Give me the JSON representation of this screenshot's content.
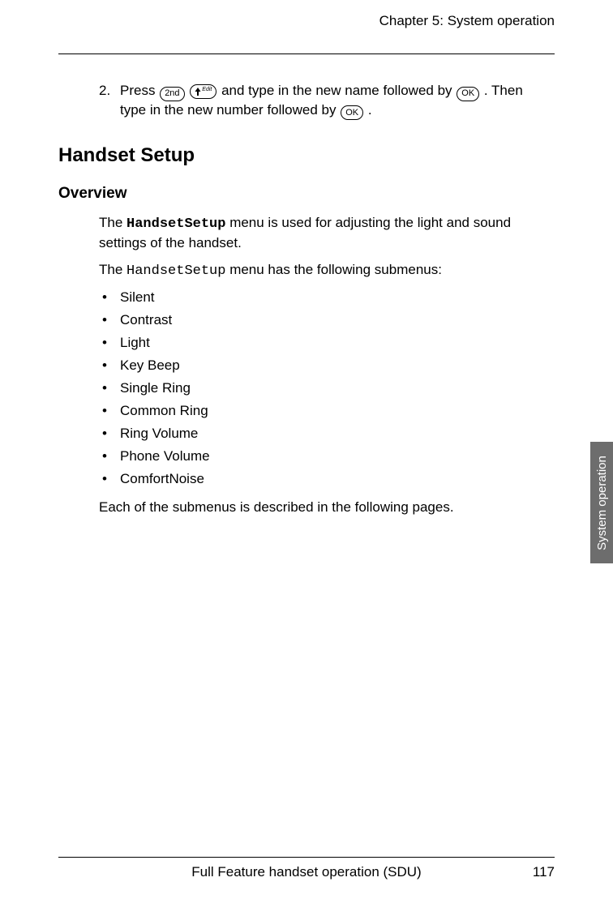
{
  "runningHead": "Chapter 5:  System operation",
  "step": {
    "number": "2.",
    "text1": "Press ",
    "key2nd": "2nd",
    "keyEditSup": "Edit",
    "text2": " and type in the new name followed by ",
    "keyOK": "OK",
    "text3": ". Then type in the new number followed by ",
    "text4": "."
  },
  "section": "Handset Setup",
  "subsection": "Overview",
  "para1_a": "The ",
  "para1_menu": "HandsetSetup",
  "para1_b": " menu is used for adjusting the light and sound settings of the handset.",
  "para2_a": "The ",
  "para2_menu": "HandsetSetup",
  "para2_b": " menu has the following submenus:",
  "submenus": [
    "Silent",
    "Contrast",
    "Light",
    "Key Beep",
    "Single Ring",
    "Common Ring",
    "Ring Volume",
    "Phone Volume",
    "ComfortNoise"
  ],
  "closing": "Each of the submenus is described in the following pages.",
  "sideTab": "System operation",
  "footerCenter": "Full Feature handset operation (SDU)",
  "pageNumber": "117"
}
